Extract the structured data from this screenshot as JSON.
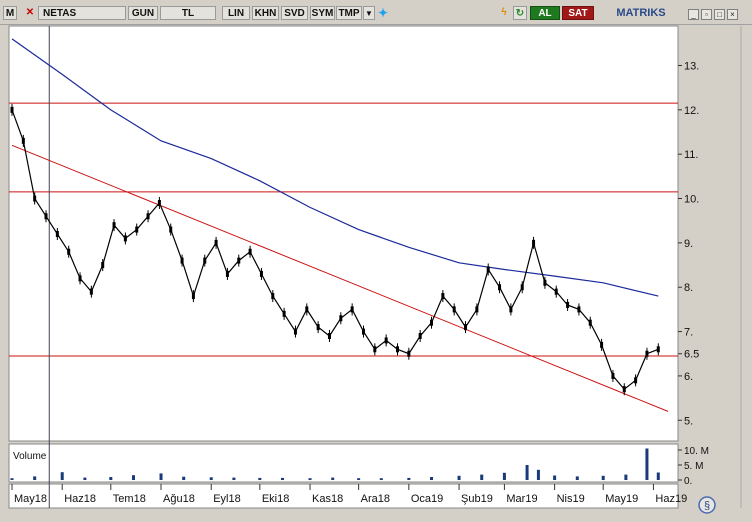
{
  "toolbar": {
    "menu_label": "M",
    "symbol": "NETAS",
    "period": "GUN",
    "currency": "TL",
    "scale_lin": "LIN",
    "khn": "KHN",
    "svd": "SVD",
    "sym": "SYM",
    "tmp": "TMP",
    "buy_label": "AL",
    "sell_label": "SAT",
    "brand": "MATRIKS",
    "twitter_icon": "twitter-bird-icon",
    "colors": {
      "buy": "#1e7a1e",
      "sell": "#a01818",
      "brand": "#2a4a8a"
    }
  },
  "volume_panel": {
    "label": "Volume"
  },
  "chart_data": {
    "type": "candlestick",
    "series": [
      {
        "name": "",
        "kind": "price-daily",
        "points": [
          [
            "2018-05-01",
            12.0
          ],
          [
            "2018-05-08",
            11.3
          ],
          [
            "2018-05-15",
            10.0
          ],
          [
            "2018-05-22",
            9.6
          ],
          [
            "2018-05-29",
            9.2
          ],
          [
            "2018-06-05",
            8.8
          ],
          [
            "2018-06-12",
            8.2
          ],
          [
            "2018-06-19",
            7.9
          ],
          [
            "2018-06-26",
            8.5
          ],
          [
            "2018-07-03",
            9.4
          ],
          [
            "2018-07-10",
            9.1
          ],
          [
            "2018-07-17",
            9.3
          ],
          [
            "2018-07-24",
            9.6
          ],
          [
            "2018-07-31",
            9.9
          ],
          [
            "2018-08-07",
            9.3
          ],
          [
            "2018-08-14",
            8.6
          ],
          [
            "2018-08-21",
            7.8
          ],
          [
            "2018-08-28",
            8.6
          ],
          [
            "2018-09-04",
            9.0
          ],
          [
            "2018-09-11",
            8.3
          ],
          [
            "2018-09-18",
            8.6
          ],
          [
            "2018-09-25",
            8.8
          ],
          [
            "2018-10-02",
            8.3
          ],
          [
            "2018-10-09",
            7.8
          ],
          [
            "2018-10-16",
            7.4
          ],
          [
            "2018-10-23",
            7.0
          ],
          [
            "2018-10-30",
            7.5
          ],
          [
            "2018-11-06",
            7.1
          ],
          [
            "2018-11-13",
            6.9
          ],
          [
            "2018-11-20",
            7.3
          ],
          [
            "2018-11-27",
            7.5
          ],
          [
            "2018-12-04",
            7.0
          ],
          [
            "2018-12-11",
            6.6
          ],
          [
            "2018-12-18",
            6.8
          ],
          [
            "2018-12-25",
            6.6
          ],
          [
            "2019-01-01",
            6.5
          ],
          [
            "2019-01-08",
            6.9
          ],
          [
            "2019-01-15",
            7.2
          ],
          [
            "2019-01-22",
            7.8
          ],
          [
            "2019-01-29",
            7.5
          ],
          [
            "2019-02-05",
            7.1
          ],
          [
            "2019-02-12",
            7.5
          ],
          [
            "2019-02-19",
            8.4
          ],
          [
            "2019-02-26",
            8.0
          ],
          [
            "2019-03-05",
            7.5
          ],
          [
            "2019-03-12",
            8.0
          ],
          [
            "2019-03-19",
            9.0
          ],
          [
            "2019-03-26",
            8.1
          ],
          [
            "2019-04-02",
            7.9
          ],
          [
            "2019-04-09",
            7.6
          ],
          [
            "2019-04-16",
            7.5
          ],
          [
            "2019-04-23",
            7.2
          ],
          [
            "2019-04-30",
            6.7
          ],
          [
            "2019-05-07",
            6.0
          ],
          [
            "2019-05-14",
            5.7
          ],
          [
            "2019-05-21",
            5.9
          ],
          [
            "2019-05-28",
            6.5
          ],
          [
            "2019-06-04",
            6.6
          ]
        ]
      },
      {
        "name": "",
        "kind": "moving-average",
        "points": [
          [
            "2018-05-01",
            13.6
          ],
          [
            "2018-06-01",
            12.8
          ],
          [
            "2018-07-01",
            12.0
          ],
          [
            "2018-08-01",
            11.3
          ],
          [
            "2018-09-01",
            10.9
          ],
          [
            "2018-10-01",
            10.4
          ],
          [
            "2018-11-01",
            9.8
          ],
          [
            "2018-12-01",
            9.3
          ],
          [
            "2019-01-01",
            8.9
          ],
          [
            "2019-02-01",
            8.55
          ],
          [
            "2019-03-01",
            8.4
          ],
          [
            "2019-04-01",
            8.25
          ],
          [
            "2019-05-01",
            8.1
          ],
          [
            "2019-06-04",
            7.8
          ]
        ]
      }
    ],
    "volume_m": [
      [
        "2018-05-01",
        0.6
      ],
      [
        "2018-05-15",
        1.2
      ],
      [
        "2018-06-01",
        2.6
      ],
      [
        "2018-06-15",
        0.8
      ],
      [
        "2018-07-01",
        1.0
      ],
      [
        "2018-07-15",
        1.6
      ],
      [
        "2018-08-01",
        2.2
      ],
      [
        "2018-08-15",
        1.1
      ],
      [
        "2018-09-01",
        0.9
      ],
      [
        "2018-09-15",
        0.8
      ],
      [
        "2018-10-01",
        0.7
      ],
      [
        "2018-10-15",
        0.7
      ],
      [
        "2018-11-01",
        0.6
      ],
      [
        "2018-11-15",
        0.8
      ],
      [
        "2018-12-01",
        0.6
      ],
      [
        "2018-12-15",
        0.6
      ],
      [
        "2019-01-01",
        0.7
      ],
      [
        "2019-01-15",
        1.0
      ],
      [
        "2019-02-01",
        1.4
      ],
      [
        "2019-02-15",
        1.8
      ],
      [
        "2019-03-01",
        2.4
      ],
      [
        "2019-03-15",
        5.0
      ],
      [
        "2019-03-22",
        3.4
      ],
      [
        "2019-04-01",
        1.5
      ],
      [
        "2019-04-15",
        1.2
      ],
      [
        "2019-05-01",
        1.4
      ],
      [
        "2019-05-15",
        1.8
      ],
      [
        "2019-05-28",
        10.5
      ],
      [
        "2019-06-04",
        2.5
      ]
    ],
    "horizontal_lines": [
      12.15,
      10.15,
      6.45
    ],
    "trendline": {
      "from": [
        "2018-05-01",
        11.2
      ],
      "to": [
        "2019-06-10",
        5.2
      ]
    },
    "vertical_marker": "2018-05-24",
    "price_ticks": [
      13,
      12,
      11,
      10,
      9,
      8,
      7,
      6.5,
      6,
      5
    ],
    "price_tick_labels": [
      "13.",
      "12.",
      "11.",
      "10.",
      "9.",
      "8.",
      "7.",
      "6.5",
      "6.",
      "5."
    ],
    "volume_ticks": [
      "10. M",
      "5. M",
      "0."
    ],
    "volume_tick_values": [
      10,
      5,
      0
    ],
    "x_ticks": [
      "May18",
      "Haz18",
      "Tem18",
      "Ağu18",
      "Eyl18",
      "Eki18",
      "Kas18",
      "Ara18",
      "Oca19",
      "Şub19",
      "Mar19",
      "Nis19",
      "May19",
      "Haz19"
    ],
    "x_tick_dates": [
      "2018-05-01",
      "2018-06-01",
      "2018-07-01",
      "2018-08-01",
      "2018-09-01",
      "2018-10-01",
      "2018-11-01",
      "2018-12-01",
      "2019-01-01",
      "2019-02-01",
      "2019-03-01",
      "2019-04-01",
      "2019-05-01",
      "2019-06-01"
    ],
    "ylim": [
      4.6,
      13.8
    ],
    "grid": false,
    "colors": {
      "price": "#000000",
      "moving_average": "#1a2a9a",
      "lines": "#cc1111",
      "volume": "#1a3a7a"
    }
  }
}
